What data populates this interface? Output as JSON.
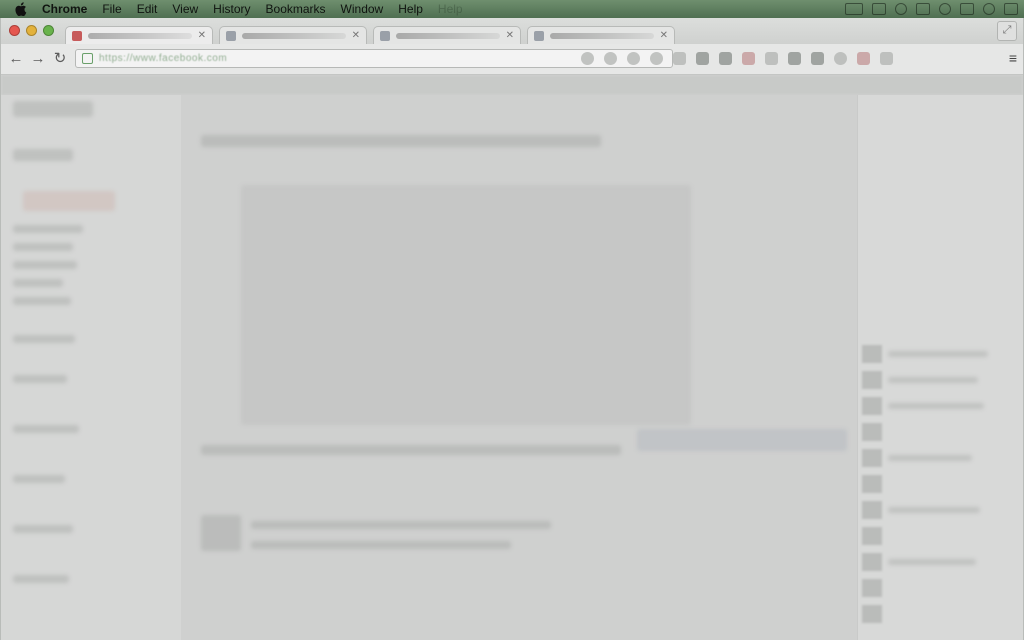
{
  "menubar": {
    "app": "Chrome",
    "items": [
      "File",
      "Edit",
      "View",
      "History",
      "Bookmarks",
      "Window",
      "Help"
    ],
    "ghost_item": "Help"
  },
  "browser": {
    "url": "https://www.facebook.com",
    "tab_count": 4
  },
  "colors": {
    "menubar": "#5b7a5b",
    "chrome_frame": "#d1d3d1",
    "close_button": "#e5574f",
    "minimize_button": "#e3b23c",
    "zoom_button": "#69b34c"
  },
  "icons": {
    "apple": "apple-logo-icon",
    "back": "back-arrow-icon",
    "forward": "forward-arrow-icon",
    "reload": "reload-icon",
    "menu": "hamburger-menu-icon"
  }
}
